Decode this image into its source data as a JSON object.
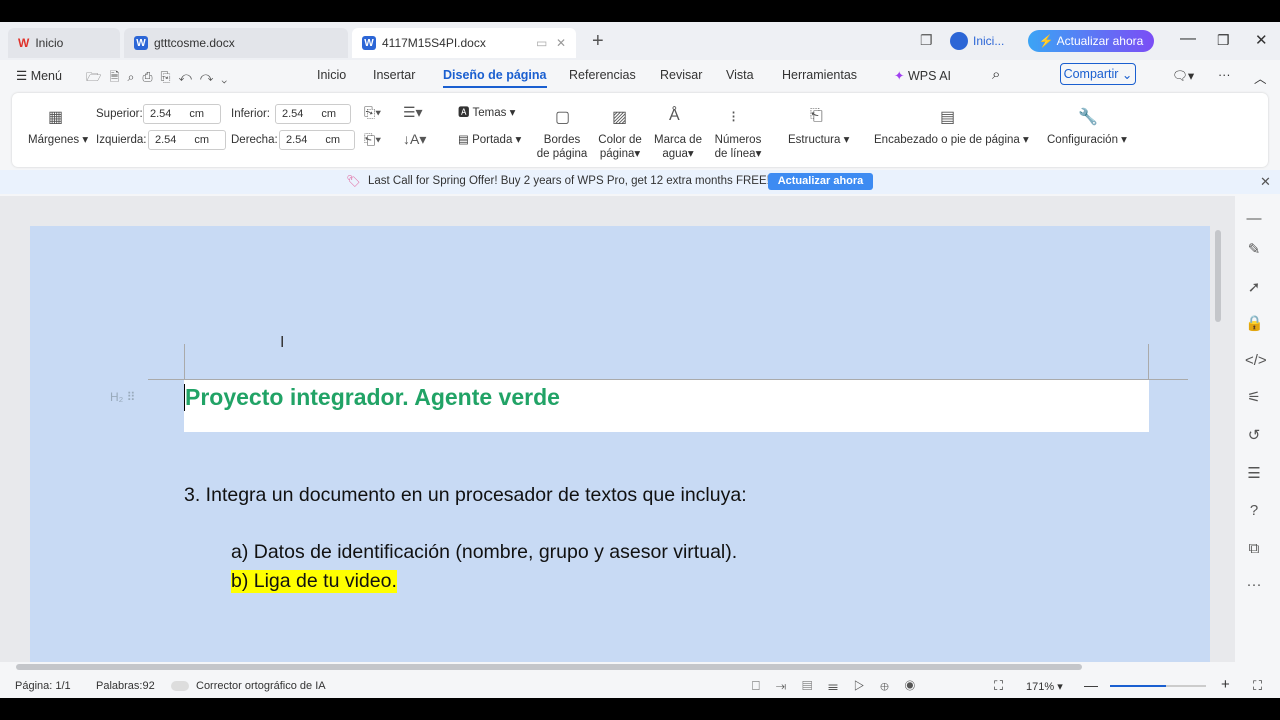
{
  "tabs": [
    {
      "label": "Inicio"
    },
    {
      "label": "gtttcosme.docx"
    },
    {
      "label": "4117M15S4PI.docx"
    }
  ],
  "titlebar": {
    "account": "Inici...",
    "upgrade": "Actualizar ahora"
  },
  "menu": {
    "menu_label": "Menú",
    "items": [
      "Inicio",
      "Insertar",
      "Diseño de página",
      "Referencias",
      "Revisar",
      "Vista",
      "Herramientas"
    ],
    "active": "Diseño de página",
    "wps_ai": "WPS AI",
    "share": "Compartir"
  },
  "ribbon": {
    "margins": "Márgenes",
    "top_label": "Superior:",
    "top": "2.54",
    "bottom_label": "Inferior:",
    "bottom": "2.54",
    "left_label": "Izquierda:",
    "left": "2.54",
    "right_label": "Derecha:",
    "right": "2.54",
    "unit": "cm",
    "themes": "Temas",
    "cover": "Portada",
    "borders": [
      "Bordes",
      "de página"
    ],
    "color": [
      "Color de",
      "página"
    ],
    "watermark": [
      "Marca de",
      "agua"
    ],
    "line_numbers": [
      "Números",
      "de línea"
    ],
    "structure": "Estructura",
    "header_footer": "Encabezado o pie de página",
    "settings": "Configuración"
  },
  "promo": {
    "text": "Last Call for Spring Offer! Buy 2 years of WPS Pro, get 12 extra months FREE!",
    "button": "Actualizar ahora"
  },
  "document": {
    "heading": "Proyecto integrador. Agente verde",
    "item3": "3. Integra un documento en un procesador de textos que incluya:",
    "a": "a) Datos de identificación (nombre, grupo y asesor virtual).",
    "b": "b) Liga de tu video."
  },
  "status": {
    "page": "Página: 1/1",
    "words": "Palabras:92",
    "spell": "Corrector ortográfico de IA",
    "zoom": "171%"
  },
  "colors": {
    "accent": "#1a5fd0",
    "heading": "#21a366",
    "highlight": "#ffff00",
    "selection": "#c8daf4"
  }
}
